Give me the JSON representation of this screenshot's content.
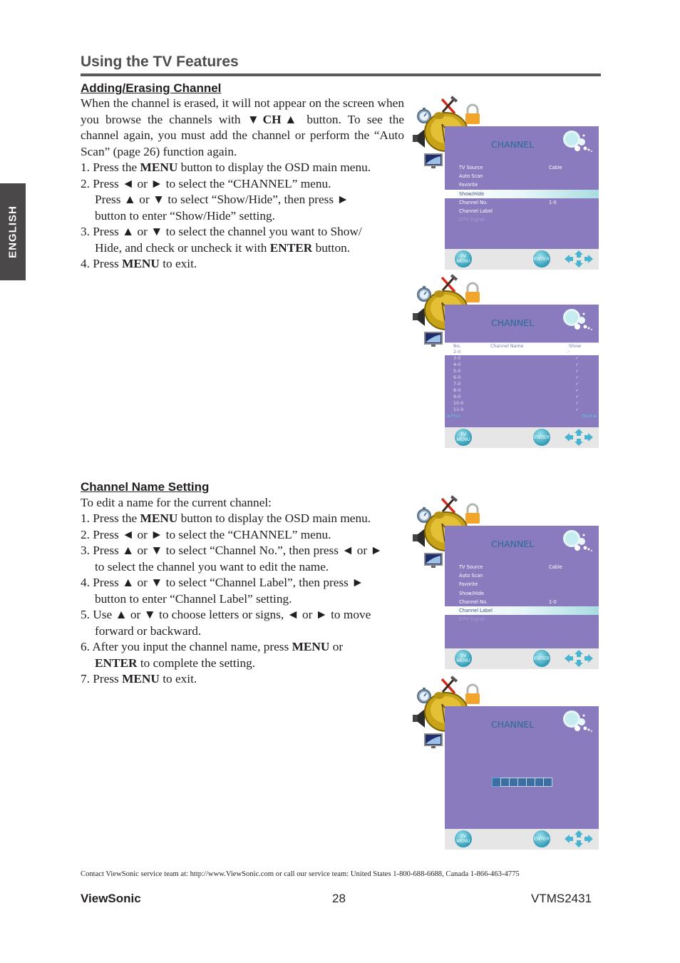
{
  "page": {
    "section_title": "Using the TV Features",
    "language_tab": "ENGLISH"
  },
  "adding_erasing": {
    "heading": "Adding/Erasing Channel",
    "intro_parts": [
      "When the channel is erased, it will not appear on the screen when you browse the channels with ",
      "▼CH▲",
      " button. To see the channel again, you must add the channel or perform the “Auto Scan” (page 26) function again."
    ],
    "steps": [
      {
        "lines": [
          [
            "1. Press the ",
            "MENU",
            " button to display the OSD main menu."
          ]
        ]
      },
      {
        "lines": [
          [
            "2. Press ◄ or ► to select the “CHANNEL” menu."
          ],
          [
            "Press ▲ or ▼ to select “Show/Hide”, then press ►"
          ],
          [
            "button to enter “Show/Hide” setting."
          ]
        ]
      },
      {
        "lines": [
          [
            "3. Press ▲ or ▼ to select the channel you want to Show/"
          ],
          [
            "Hide, and check or uncheck it with ",
            "ENTER",
            " button."
          ]
        ]
      },
      {
        "lines": [
          [
            "4. Press ",
            "MENU",
            " to exit."
          ]
        ]
      }
    ]
  },
  "channel_name": {
    "heading": "Channel Name Setting",
    "intro": "To edit a name for the current channel:",
    "steps": [
      {
        "lines": [
          [
            "1. Press the ",
            "MENU",
            " button to display the OSD main menu."
          ]
        ]
      },
      {
        "lines": [
          [
            "2. Press ◄ or ► to select the “CHANNEL” menu."
          ]
        ]
      },
      {
        "lines": [
          [
            "3. Press ▲ or ▼ to select “Channel No.”, then press ◄ or ►"
          ],
          [
            "to select the channel you want to edit the name."
          ]
        ]
      },
      {
        "lines": [
          [
            "4. Press ▲ or ▼ to select “Channel Label”, then press ►"
          ],
          [
            "button to enter “Channel Label” setting."
          ]
        ]
      },
      {
        "lines": [
          [
            "5. Use ▲ or ▼ to choose letters or signs, ◄ or ► to move"
          ],
          [
            "forward or backward."
          ]
        ]
      },
      {
        "lines": [
          [
            "6. After you input the channel name, press ",
            "MENU",
            " or"
          ],
          [
            "",
            "ENTER",
            " to complete the setting."
          ]
        ]
      },
      {
        "lines": [
          [
            "7. Press ",
            "MENU",
            " to exit."
          ]
        ]
      }
    ]
  },
  "osd": {
    "title": "CHANNEL",
    "menu_items": [
      {
        "label": "TV Source",
        "value": "Cable"
      },
      {
        "label": "Auto Scan",
        "value": ""
      },
      {
        "label": "Favorite",
        "value": ""
      },
      {
        "label": "Show/Hide",
        "value": ""
      },
      {
        "label": "Channel No.",
        "value": "1-0"
      },
      {
        "label": "Channel Label",
        "value": ""
      },
      {
        "label": "DTV Signal",
        "value": "",
        "disabled": true
      }
    ],
    "screen1_selected": "Show/Hide",
    "screen3_selected": "Channel Label",
    "table": {
      "headers": [
        "No.",
        "Channel Name",
        "Show"
      ],
      "rows": [
        {
          "no": "2-0",
          "name": "",
          "show": "✓"
        },
        {
          "no": "3-0",
          "name": "",
          "show": "✓"
        },
        {
          "no": "4-0",
          "name": "",
          "show": "✓"
        },
        {
          "no": "5-0",
          "name": "",
          "show": "✓"
        },
        {
          "no": "6-0",
          "name": "",
          "show": "✓"
        },
        {
          "no": "7-0",
          "name": "",
          "show": "✓"
        },
        {
          "no": "8-0",
          "name": "",
          "show": "✓"
        },
        {
          "no": "9-0",
          "name": "",
          "show": "✓"
        },
        {
          "no": "10-0",
          "name": "",
          "show": "✓"
        },
        {
          "no": "11-0",
          "name": "",
          "show": "✓"
        }
      ],
      "prev": "◄ Prev",
      "next": "Next ►"
    },
    "label_box_count": 7,
    "footer": {
      "menu_btn": "TV MENU",
      "enter_btn": "ENTER"
    }
  },
  "footer": {
    "contact": "Contact ViewSonic service team at: http://www.ViewSonic.com or call our service team: United States 1-800-688-6688, Canada 1-866-463-4775",
    "brand": "ViewSonic",
    "page_number": "28",
    "model": "VTMS2431"
  }
}
